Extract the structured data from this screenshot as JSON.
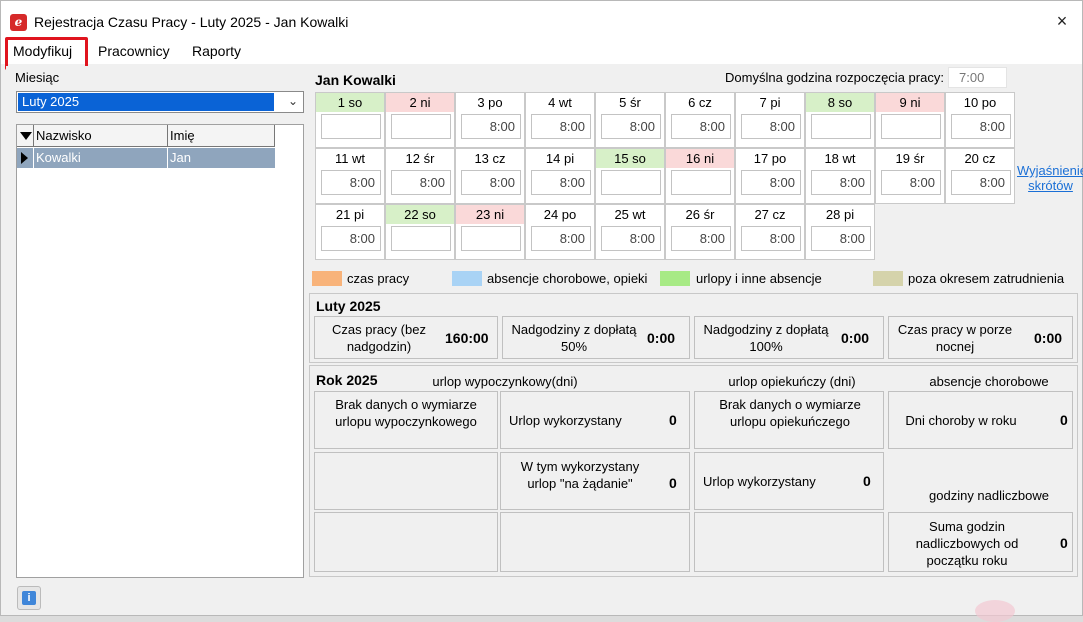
{
  "window": {
    "title": "Rejestracja Czasu Pracy - Luty 2025 - Jan Kowalki",
    "close_icon": "×"
  },
  "menu": [
    "Modyfikuj",
    "Pracownicy",
    "Raporty"
  ],
  "left": {
    "month_label": "Miesiąc",
    "month_value": "Luty 2025",
    "columns": [
      "Nazwisko",
      "Imię"
    ],
    "rows": [
      {
        "surname": "Kowalki",
        "name": "Jan"
      }
    ]
  },
  "right": {
    "employee": "Jan Kowalki",
    "start_label": "Domyślna godzina rozpoczęcia pracy:",
    "start_value": "7:00",
    "explain_link_1": "Wyjaśnienie",
    "explain_link_2": "skrótów"
  },
  "days": [
    {
      "label": "1 so",
      "type": "we",
      "value": ""
    },
    {
      "label": "2 ni",
      "type": "su",
      "value": ""
    },
    {
      "label": "3 po",
      "type": "wd",
      "value": "8:00"
    },
    {
      "label": "4 wt",
      "type": "wd",
      "value": "8:00"
    },
    {
      "label": "5 śr",
      "type": "wd",
      "value": "8:00"
    },
    {
      "label": "6 cz",
      "type": "wd",
      "value": "8:00"
    },
    {
      "label": "7 pi",
      "type": "wd",
      "value": "8:00"
    },
    {
      "label": "8 so",
      "type": "we",
      "value": ""
    },
    {
      "label": "9 ni",
      "type": "su",
      "value": ""
    },
    {
      "label": "10 po",
      "type": "wd",
      "value": "8:00"
    },
    {
      "label": "11 wt",
      "type": "wd",
      "value": "8:00"
    },
    {
      "label": "12 śr",
      "type": "wd",
      "value": "8:00"
    },
    {
      "label": "13 cz",
      "type": "wd",
      "value": "8:00"
    },
    {
      "label": "14 pi",
      "type": "wd",
      "value": "8:00"
    },
    {
      "label": "15 so",
      "type": "we",
      "value": ""
    },
    {
      "label": "16 ni",
      "type": "su",
      "value": ""
    },
    {
      "label": "17 po",
      "type": "wd",
      "value": "8:00"
    },
    {
      "label": "18 wt",
      "type": "wd",
      "value": "8:00"
    },
    {
      "label": "19 śr",
      "type": "wd",
      "value": "8:00"
    },
    {
      "label": "20 cz",
      "type": "wd",
      "value": "8:00"
    },
    {
      "label": "21 pi",
      "type": "wd",
      "value": "8:00"
    },
    {
      "label": "22 so",
      "type": "we",
      "value": ""
    },
    {
      "label": "23 ni",
      "type": "su",
      "value": ""
    },
    {
      "label": "24 po",
      "type": "wd",
      "value": "8:00"
    },
    {
      "label": "25 wt",
      "type": "wd",
      "value": "8:00"
    },
    {
      "label": "26 śr",
      "type": "wd",
      "value": "8:00"
    },
    {
      "label": "27 cz",
      "type": "wd",
      "value": "8:00"
    },
    {
      "label": "28 pi",
      "type": "wd",
      "value": "8:00"
    }
  ],
  "legend": [
    {
      "label": "czas pracy",
      "color": "#f8b37a"
    },
    {
      "label": "absencje chorobowe, opieki",
      "color": "#a9d3f5"
    },
    {
      "label": "urlopy i inne absencje",
      "color": "#a7ea85"
    },
    {
      "label": "poza okresem zatrudnienia",
      "color": "#d5d3ab"
    }
  ],
  "month_summary": {
    "title": "Luty 2025",
    "items": [
      {
        "label": "Czas pracy (bez nadgodzin)",
        "value": "160:00"
      },
      {
        "label": "Nadgodziny z dopłatą 50%",
        "value": "0:00"
      },
      {
        "label": "Nadgodziny z dopłatą 100%",
        "value": "0:00"
      },
      {
        "label": "Czas pracy w porze nocnej",
        "value": "0:00"
      }
    ]
  },
  "year_summary": {
    "title": "Rok 2025",
    "col1_header": "urlop wypoczynkowy(dni)",
    "col2_header": "urlop opiekuńczy (dni)",
    "col3_header": "absencje chorobowe",
    "no_data_vac": "Brak danych o wymiarze urlopu wypoczynkowego",
    "vac_used_label": "Urlop wykorzystany",
    "vac_used_value": "0",
    "no_data_care": "Brak danych o wymiarze urlopu opiekuńczego",
    "sick_label": "Dni choroby w roku",
    "sick_value": "0",
    "on_demand_label": "W tym wykorzystany urlop \"na żądanie\"",
    "on_demand_value": "0",
    "care_used_label": "Urlop wykorzystany",
    "care_used_value": "0",
    "overtime_header": "godziny nadliczbowe",
    "overtime_sum_label": "Suma godzin nadliczbowych od początku roku",
    "overtime_sum_value": "0"
  }
}
